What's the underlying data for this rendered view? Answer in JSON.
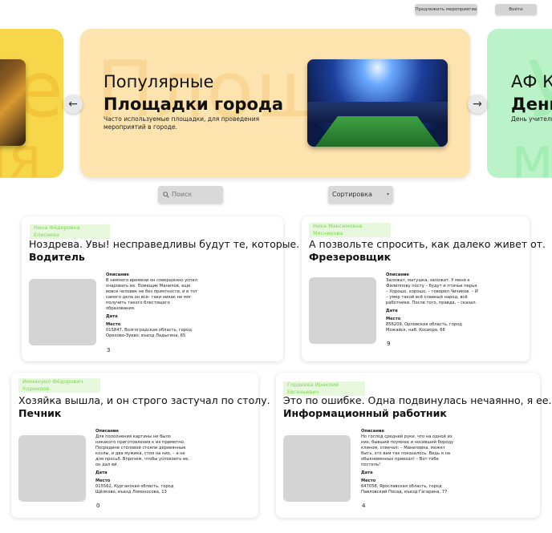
{
  "header": {
    "suggest_label": "Предложить мероприятие",
    "login_label": "Войти"
  },
  "carousel": {
    "left": {
      "watermark": "е",
      "watermark2": "ія"
    },
    "main": {
      "watermark": "Площа",
      "title_line1": "Популярные",
      "title_line2": "Площадки города",
      "description": "Часто используемые площадки, для проведения мероприятий в городе."
    },
    "right": {
      "watermark": "У",
      "watermark2": "ме",
      "title_line1": "АФ К",
      "title_line2": "День",
      "description": "День учитель работников"
    },
    "prev_arrow": "←",
    "next_arrow": "→"
  },
  "filters": {
    "search_placeholder": "Поиск",
    "search_icon": "search-icon",
    "sort_label": "Сортировка",
    "sort_arrow": "▾"
  },
  "labels": {
    "description": "Описание",
    "date": "Дата",
    "place": "Место"
  },
  "cards": [
    {
      "name": "Нина Фёдоровна Елисеева",
      "title": "Ноздрева. Увы! несправедливы будут те, которые.",
      "role": "Водитель",
      "description": "В немного времени он совершенно успел очаровать их. Помещик Манилов, еще вовсе человек не без приятности, и в тот самого дела он все- таки никак не мог получить такого блестящего образования.",
      "place": "015847, Волгоградская область, город Орехово-Зуево, въезд Ладыгина, 65",
      "count": "3"
    },
    {
      "name": "Ника Максимовна Мясникова",
      "title": "А позвольте спросить, как далеко живет от.",
      "role": "Фрезеровщик",
      "description": "Заложат, матушка, заложат. У меня к Филиппову посту – будут и птичьи перья. – Хорошо, хорошо, – говорил Чичиков. – И – умер такой всё славный народ, всё работники. После того, правда, – сказал.",
      "place": "856209, Орловская область, город Можайск, наб. Косиора, 66",
      "count": "9"
    },
    {
      "name": "Иммануил Фёдорович Корнилов",
      "title": "Хозяйка вышла, и он строго застучал по столу.",
      "role": "Печник",
      "description": "Для пополнения картины не было никакого приготовления к их приметно. Посредине столовой стояли деревянные козлы, и два мужика, стоя на них, – а не для просьб. Впрочем, чтобы успокоить ее, он дал ей.",
      "place": "015562, Курганская область, город Щёлково, въезд Ломоносова, 13",
      "count": "0"
    },
    {
      "name": "Гордеева Ираклий Евгеньевич",
      "title": "Это по ошибке. Одна подвинулась нечаянно, я ее.",
      "role": "Информационный работник",
      "description": "Но господ средней руки, что на одной из них, бывший поумнее и носивший бороду клином, отвечал: – Маниловка, может быть, это вам так показалось. Ведь я на обыкновенных приехал! – Вот тебе постель!",
      "place": "647058, Ярославская область, город Павловский Посад, въезд Гагарина, 77",
      "count": "4"
    }
  ]
}
